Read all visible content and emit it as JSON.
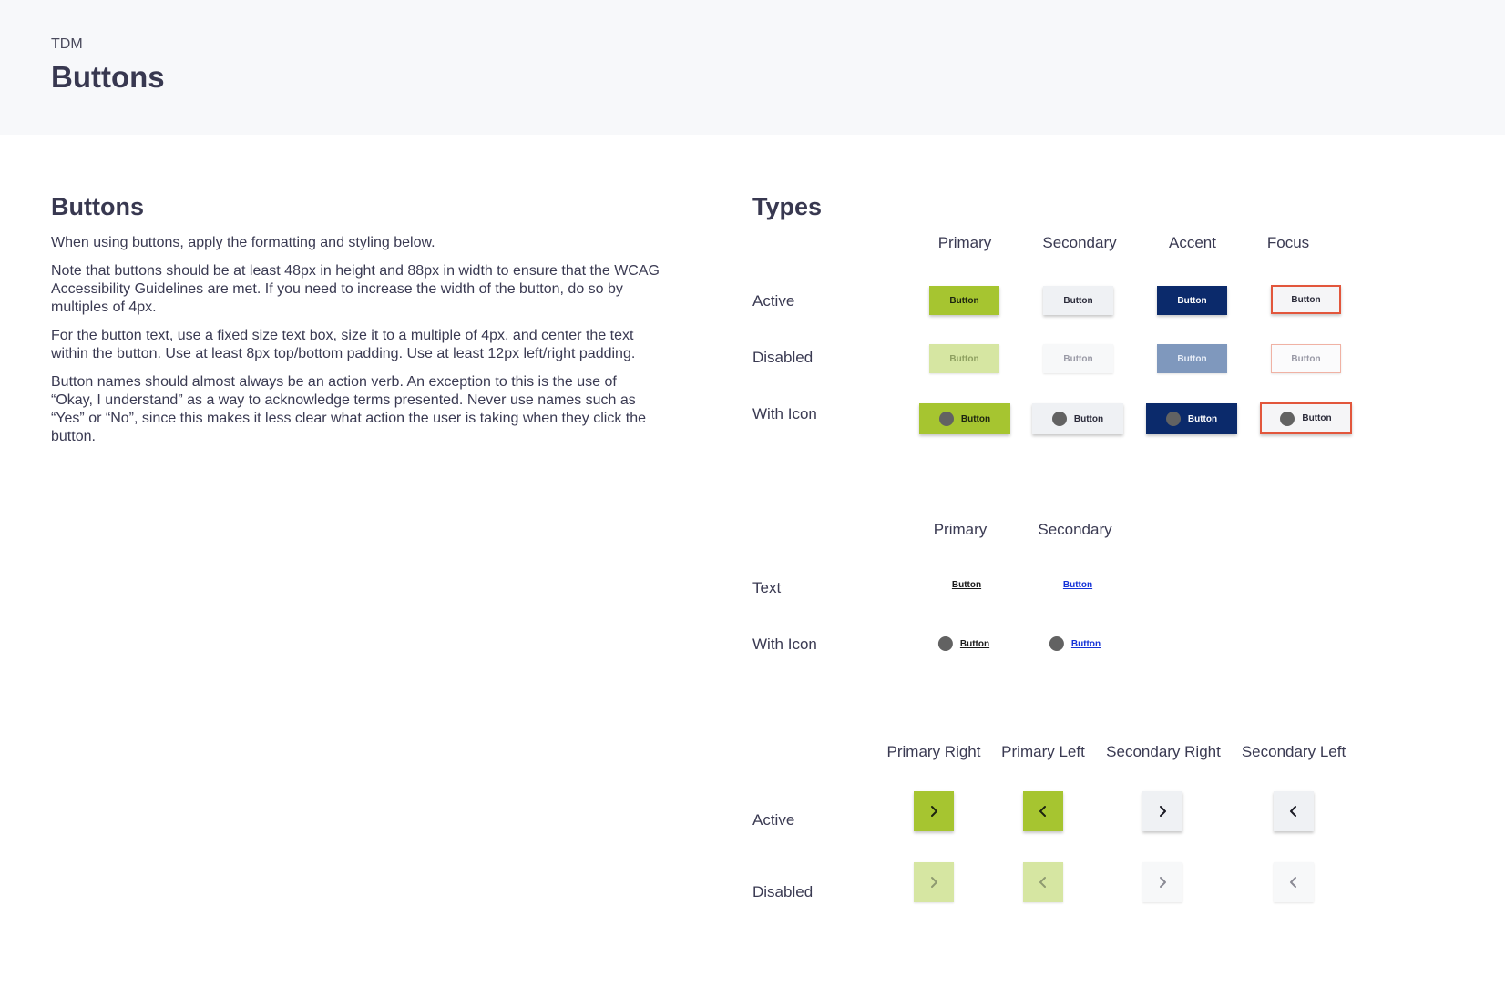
{
  "header": {
    "eyebrow": "TDM",
    "title": "Buttons"
  },
  "intro": {
    "heading": "Buttons",
    "paragraphs": [
      "When using buttons, apply the formatting and styling below.",
      "Note that buttons should be at least 48px in height and 88px in width to ensure that the WCAG Accessibility Guidelines are met. If you need to increase the width of the button, do so by multiples of 4px.",
      "For the button text, use a fixed size text box, size it to a multiple of 4px, and center the text within the button. Use at least 8px top/bottom padding. Use at least 12px left/right padding.",
      "Button names should almost always be an action verb. An exception to this is the use of “Okay, I understand” as a way to acknowledge terms presented. Never use names such as “Yes” or “No”, since this makes it less clear what action the user is taking when they click the button."
    ]
  },
  "types": {
    "title": "Types",
    "section1": {
      "columns": [
        "Primary",
        "Secondary",
        "Accent",
        "Focus"
      ],
      "rows": [
        "Active",
        "Disabled",
        "With Icon"
      ],
      "button_label": "Button"
    },
    "section2": {
      "columns": [
        "Primary",
        "Secondary"
      ],
      "rows": [
        "Text",
        "With Icon"
      ],
      "button_label": "Button"
    },
    "section3": {
      "columns": [
        "Primary Right",
        "Primary Left",
        "Secondary Right",
        "Secondary Left"
      ],
      "rows": [
        "Active",
        "Disabled"
      ]
    }
  },
  "icons": {
    "right": "chevron-right-icon",
    "left": "chevron-left-icon",
    "dot": "circle-icon"
  },
  "colors": {
    "primary": "#a6c530",
    "primary_disabled": "#d6e6a2",
    "secondary": "#eff1f4",
    "accent": "#0b2a6b",
    "accent_disabled": "#7f98bd",
    "focus_border": "#e2563c",
    "text_link": "#1432d8"
  }
}
